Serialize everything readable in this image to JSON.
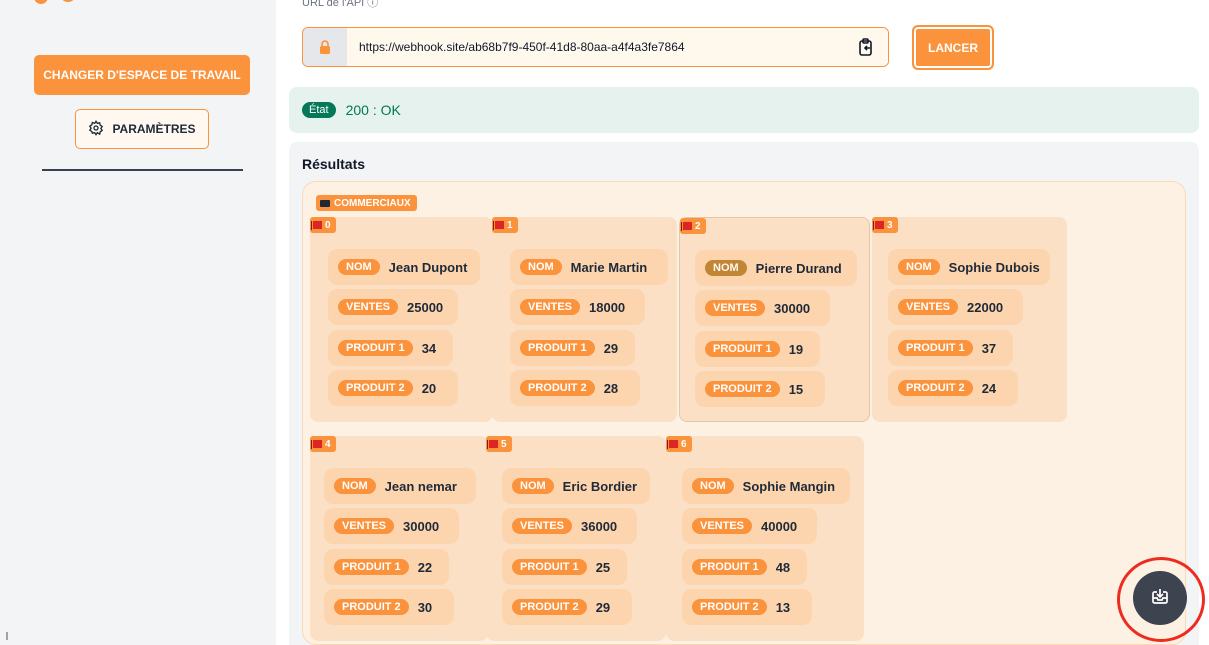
{
  "sidebar": {
    "workspace_button": "CHANGER D'ESPACE DE TRAVAIL",
    "settings_button": "PARAMÈTRES",
    "settings_icon": "gear-icon"
  },
  "api": {
    "url_label": "URL de l'API",
    "url_value": "https://webhook.site/ab68b7f9-450f-41d8-80aa-a4f4a3fe7864",
    "launch_button": "LANCER",
    "lock_icon": "lock-icon",
    "copy_icon": "clipboard-icon"
  },
  "status": {
    "badge": "État",
    "text": "200 : OK",
    "color": "#047857"
  },
  "results": {
    "title": "Résultats",
    "group_label": "COMMERCIAUX",
    "records": [
      {
        "index": "0",
        "nom": "Jean Dupont",
        "ventes": "25000",
        "produit1": "34",
        "produit2": "20"
      },
      {
        "index": "1",
        "nom": "Marie Martin",
        "ventes": "18000",
        "produit1": "29",
        "produit2": "28"
      },
      {
        "index": "2",
        "nom": "Pierre Durand",
        "ventes": "30000",
        "produit1": "19",
        "produit2": "15"
      },
      {
        "index": "3",
        "nom": "Sophie Dubois",
        "ventes": "22000",
        "produit1": "37",
        "produit2": "24"
      },
      {
        "index": "4",
        "nom": "Jean nemar",
        "ventes": "30000",
        "produit1": "22",
        "produit2": "30"
      },
      {
        "index": "5",
        "nom": "Eric Bordier",
        "ventes": "36000",
        "produit1": "25",
        "produit2": "29"
      },
      {
        "index": "6",
        "nom": "Sophie Mangin",
        "ventes": "40000",
        "produit1": "48",
        "produit2": "13"
      }
    ],
    "keys": {
      "nom": "NOM",
      "ventes": "VENTES",
      "produit1": "PRODUIT 1",
      "produit2": "PRODUIT 2"
    }
  },
  "fab": {
    "icon": "download-tray-icon"
  },
  "colors": {
    "accent": "#fb923c",
    "highlight_ring": "#ef2b1f"
  }
}
